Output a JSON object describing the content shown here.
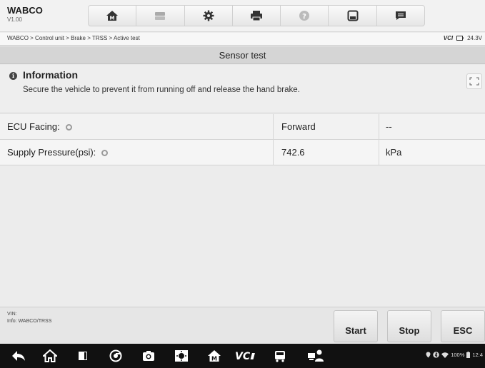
{
  "app": {
    "name": "WABCO",
    "version": "V1.00"
  },
  "toolbar": {
    "buttons": [
      {
        "icon": "home-icon"
      },
      {
        "icon": "vehicle-swap-icon"
      },
      {
        "icon": "settings-icon"
      },
      {
        "icon": "print-icon"
      },
      {
        "icon": "help-icon"
      },
      {
        "icon": "save-icon"
      },
      {
        "icon": "message-icon"
      }
    ]
  },
  "breadcrumb": {
    "path": "WABCO > Control unit > Brake > TRSS > Active test",
    "vci_label": "VCI",
    "battery_voltage": "24.3V"
  },
  "page": {
    "title": "Sensor test"
  },
  "info": {
    "title": "Information",
    "message": "Secure the vehicle to prevent it from running off and release the hand brake."
  },
  "table": {
    "rows": [
      {
        "name": "ECU Facing:",
        "value": "Forward",
        "unit": "--"
      },
      {
        "name": "Supply Pressure(psi):",
        "value": "742.6",
        "unit": "kPa"
      }
    ]
  },
  "footer": {
    "vin_label": "VIN:",
    "info_label": "Info: WABCO/TRSS",
    "start_label": "Start",
    "stop_label": "Stop",
    "esc_label": "ESC"
  },
  "system_status": {
    "battery": "100%",
    "time": "12:4"
  },
  "colors": {
    "toolbar_bg": "#f2f2f2",
    "title_bg": "#d5d5d5",
    "navbar_bg": "#111111"
  }
}
